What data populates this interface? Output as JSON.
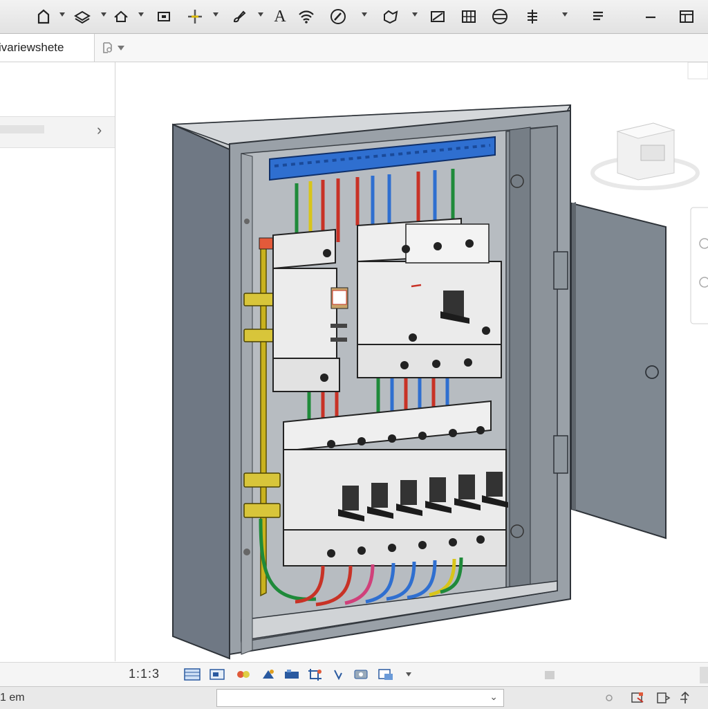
{
  "toolbar": {
    "icons": [
      "home-icon",
      "chevron-down-icon",
      "layer-icon",
      "house-icon",
      "screen-icon",
      "crosshair-icon",
      "brush-icon",
      "text-icon",
      "wifi-icon",
      "pencil-icon",
      "component-icon",
      "slash-box-icon",
      "grid-icon",
      "circle-lines-icon",
      "align-icon",
      "list-icon",
      "minimize-icon",
      "window-icon"
    ],
    "text_tool": "A"
  },
  "tab": {
    "title": "ivariewshete"
  },
  "viewbar": {
    "scale": "1:1:3"
  },
  "statusbar": {
    "text": "1 em"
  },
  "colors": {
    "toolbar_bg": "#e6e6e6",
    "cabinet": "#7c8590",
    "busbar": "#2f6fd0"
  }
}
